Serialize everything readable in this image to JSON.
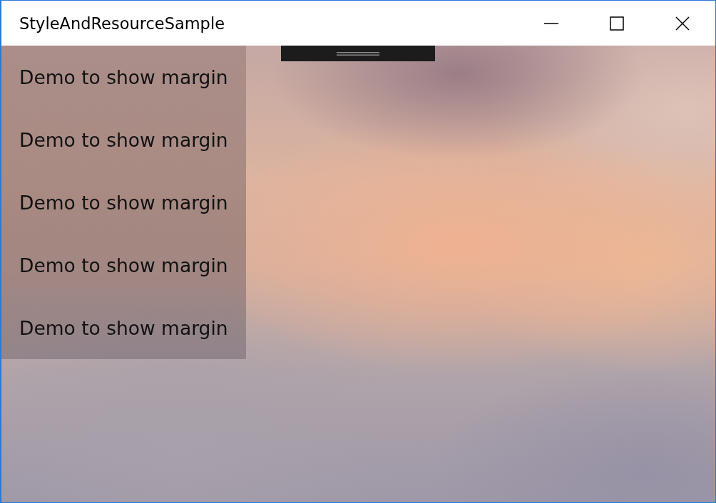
{
  "window": {
    "title": "StyleAndResourceSample"
  },
  "panel": {
    "items": [
      "Demo to show margin",
      "Demo to show margin",
      "Demo to show margin",
      "Demo to show margin",
      "Demo to show margin"
    ]
  }
}
